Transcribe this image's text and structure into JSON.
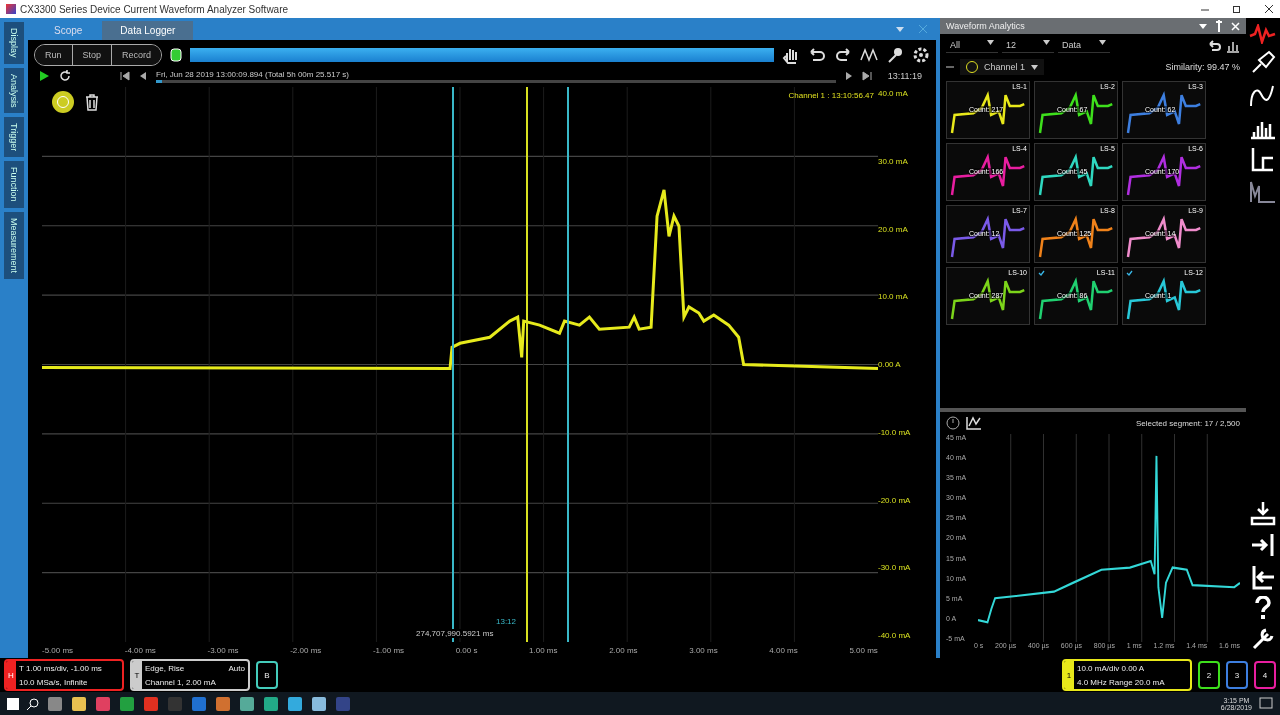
{
  "window": {
    "title": "CX3300 Series Device Current Waveform Analyzer Software"
  },
  "side_tabs": [
    {
      "label": "Display"
    },
    {
      "label": "Analysis"
    },
    {
      "label": "Trigger"
    },
    {
      "label": "Function"
    },
    {
      "label": "Measurement"
    }
  ],
  "tabs": [
    {
      "label": "Scope",
      "selected": false
    },
    {
      "label": "Data Logger",
      "selected": true
    }
  ],
  "controls": {
    "buttons": [
      "Run",
      "Stop",
      "Record"
    ],
    "progress": {
      "level": 1
    },
    "record_info": "Fri, Jun 28 2019 13:00:09.894 (Total 5h 00m 25.517 s)",
    "time": "13:11:19"
  },
  "plot": {
    "channel_label": "Channel 1 : 13:10:56.47",
    "y_labels": [
      "40.0 mA",
      "30.0 mA",
      "20.0 mA",
      "10.0 mA",
      "0.00 A",
      "-10.0 mA",
      "-20.0 mA",
      "-30.0 mA",
      "-40.0 mA"
    ],
    "x_labels": [
      "-5.00 ms",
      "-4.00 ms",
      "-3.00 ms",
      "-2.00 ms",
      "-1.00 ms",
      "0.00 s",
      "1.00 ms",
      "2.00 ms",
      "3.00 ms",
      "4.00 ms",
      "5.00 ms"
    ],
    "marker_label": "274,707,990.5921 ms",
    "cursor_label": "13:12"
  },
  "analytics": {
    "title": "Waveform Analytics",
    "filters": [
      "All",
      "12",
      "Data"
    ],
    "channel": "Channel 1",
    "similarity": "Similarity: 99.47 %",
    "segments": [
      {
        "label": "LS-1",
        "count": "Count: 217",
        "color": "#e8e81a",
        "checked": false
      },
      {
        "label": "LS-2",
        "count": "Count: 67",
        "color": "#3ee01c",
        "checked": false
      },
      {
        "label": "LS-3",
        "count": "Count: 62",
        "color": "#3d7fe0",
        "checked": false
      },
      {
        "label": "LS-4",
        "count": "Count: 166",
        "color": "#e81ea0",
        "checked": false
      },
      {
        "label": "LS-5",
        "count": "Count: 45",
        "color": "#2fd8c0",
        "checked": false
      },
      {
        "label": "LS-6",
        "count": "Count: 170",
        "color": "#b02ee0",
        "checked": false
      },
      {
        "label": "LS-7",
        "count": "Count: 12",
        "color": "#7a5ae8",
        "checked": false
      },
      {
        "label": "LS-8",
        "count": "Count: 125",
        "color": "#f0821a",
        "checked": false
      },
      {
        "label": "LS-9",
        "count": "Count: 14",
        "color": "#f08ccc",
        "checked": false
      },
      {
        "label": "LS-10",
        "count": "Count: 287",
        "color": "#7cd41a",
        "checked": false
      },
      {
        "label": "LS-11",
        "count": "Count: 86",
        "color": "#20d070",
        "checked": true
      },
      {
        "label": "LS-12",
        "count": "Count: 1",
        "color": "#28c8d8",
        "checked": true
      }
    ]
  },
  "segment_view": {
    "selected": "Selected segment: 17 / 2,500",
    "y_labels": [
      "45 mA",
      "40 mA",
      "35 mA",
      "30 mA",
      "25 mA",
      "20 mA",
      "15 mA",
      "10 mA",
      "5 mA",
      "0 A",
      "-5 mA"
    ],
    "x_labels": [
      "0 s",
      "200 µs",
      "400 µs",
      "600 µs",
      "800 µs",
      "1 ms",
      "1.2 ms",
      "1.4 ms",
      "1.6 ms"
    ]
  },
  "status": {
    "timebase": [
      "T 1.00 ms/div, -1.00 ms",
      "10.0 MSa/s, Infinite"
    ],
    "timebase_key": "H",
    "trigger": [
      "Edge, Rise",
      "Channel 1, 2.00 mA"
    ],
    "trigger_mode": "Auto",
    "trigger_key": "T",
    "extra": "B",
    "channels": [
      {
        "label": "1",
        "lines": [
          "10.0 mA/div  0.00 A",
          "4.0 MHz  Range 20.0 mA"
        ],
        "on": true,
        "color": "#e8e81a"
      },
      {
        "label": "2",
        "on": false,
        "color": "#3ee01c"
      },
      {
        "label": "3",
        "on": false,
        "color": "#3d7fe0"
      },
      {
        "label": "4",
        "on": false,
        "color": "#e81ea0"
      }
    ]
  },
  "taskbar": {
    "time": "3:15 PM",
    "date": "6/28/2019"
  }
}
